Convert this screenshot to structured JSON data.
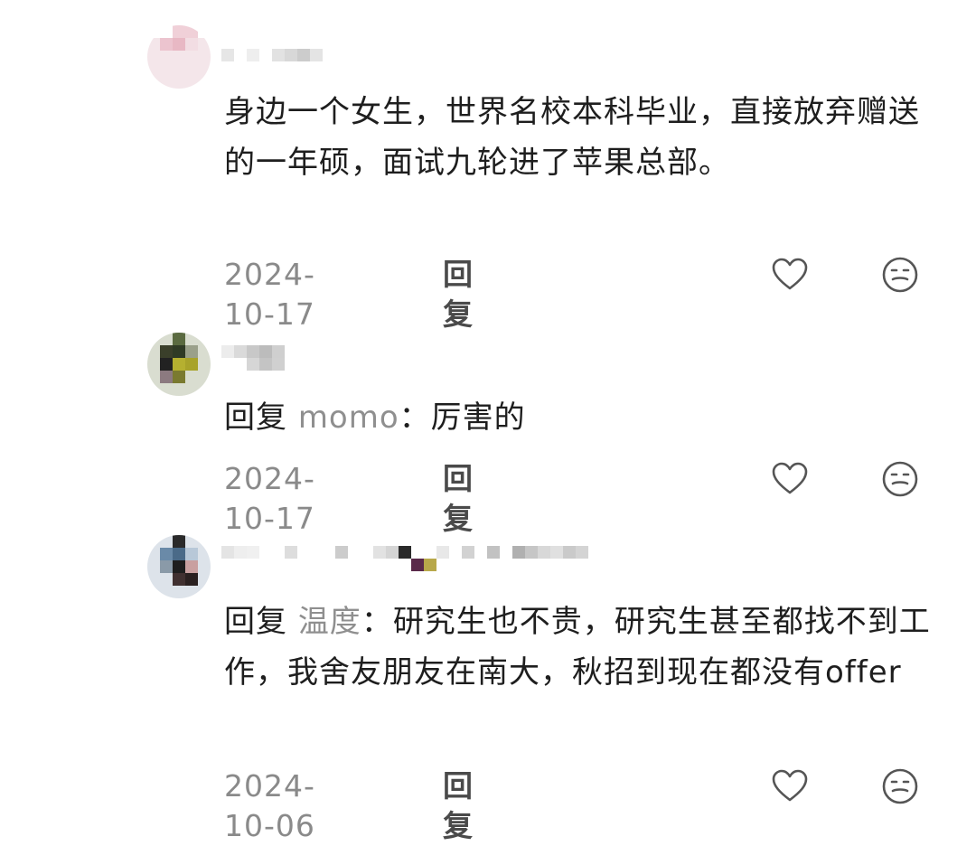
{
  "comments": [
    {
      "body": "身边一个女生，世界名校本科毕业，直接放弃赠送的一年硕，面试九轮进了苹果总部。",
      "date": "2024-10-17",
      "reply_label": "回复"
    },
    {
      "reply_prefix": "回复",
      "reply_target": "momo",
      "reply_sep": "：",
      "body": "厉害的",
      "date": "2024-10-17",
      "reply_label": "回复"
    },
    {
      "reply_prefix": "回复",
      "reply_target": "温度",
      "reply_sep": "：",
      "body": "研究生也不贵，研究生甚至都找不到工作，我舍友朋友在南大，秋招到现在都没有offer",
      "date": "2024-10-06",
      "reply_label": "回复"
    }
  ],
  "icons": {
    "like": "heart-outline-icon",
    "dislike": "neutral-face-icon"
  },
  "colors": {
    "text": "#1e1e1e",
    "meta": "#8a8a8a",
    "reply_target": "#8f8f8f",
    "icon": "#555555"
  }
}
